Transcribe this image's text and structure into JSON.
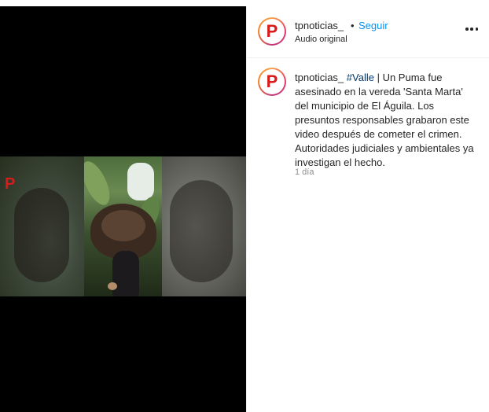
{
  "post": {
    "username": "tpnoticias_",
    "separator": "•",
    "follow_label": "Seguir",
    "audio_label": "Audio original",
    "avatar_letter": "P",
    "more_icon": "more-horizontal-icon"
  },
  "media": {
    "watermark_letter": "P"
  },
  "caption": {
    "username": "tpnoticias_",
    "hashtag": "#Valle",
    "text": " | Un Puma fue asesinado en la vereda 'Santa Marta' del municipio de El Águila. Los presuntos responsables grabaron este video después de cometer el crimen. Autoridades judiciales y ambientales ya investigan el hecho.",
    "timestamp": "1 día"
  },
  "colors": {
    "link_blue": "#0095f6",
    "hashtag": "#00376b",
    "brand_red": "#d81b1b",
    "muted": "#8e8e8e"
  }
}
